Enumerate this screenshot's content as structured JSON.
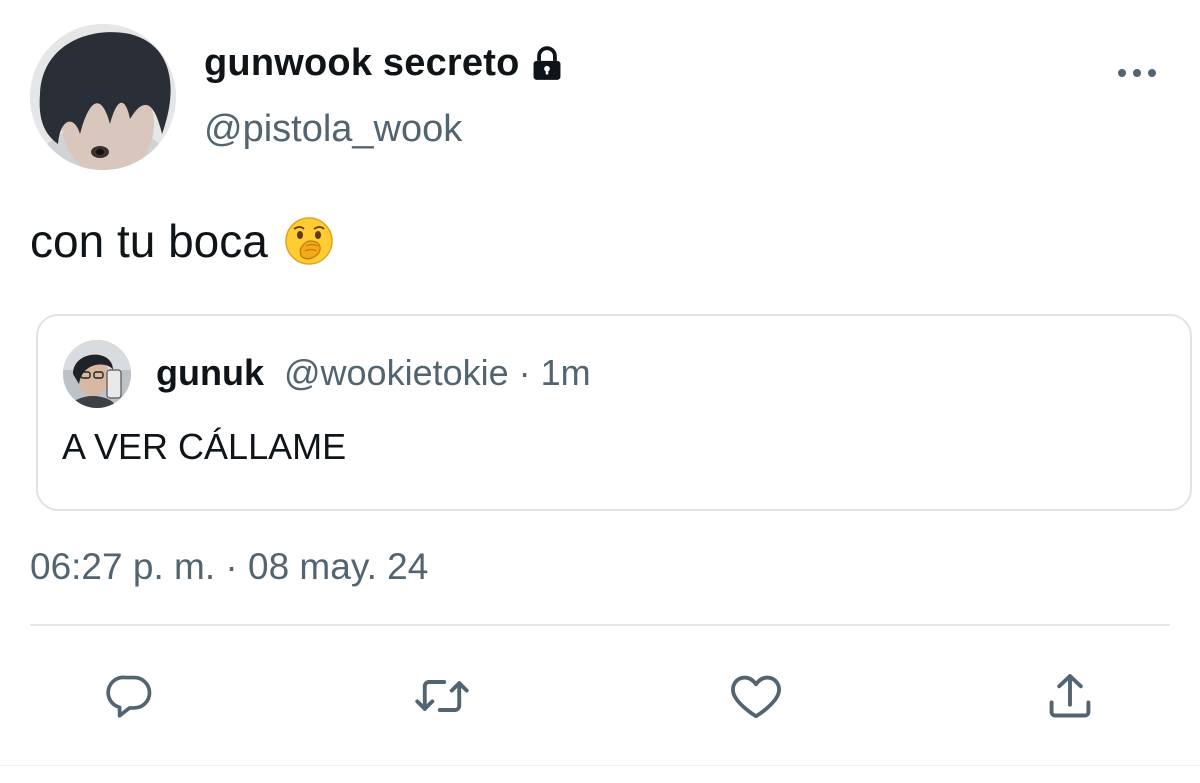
{
  "author": {
    "display_name": "gunwook secreto",
    "handle": "@pistola_wook",
    "lock_icon": "lock-icon",
    "avatar": "avatar-photo"
  },
  "tweet": {
    "text": "con tu boca",
    "emoji_icon": "hand-over-mouth-emoji"
  },
  "quote": {
    "name": "gunuk",
    "handle": "@wookietokie",
    "separator": "·",
    "time": "1m",
    "text": "A VER CÁLLAME",
    "avatar": "avatar-photo"
  },
  "timestamp": "06:27 p. m. · 08 may. 24",
  "actions": [
    {
      "icon": "reply-icon"
    },
    {
      "icon": "retweet-icon"
    },
    {
      "icon": "like-icon"
    },
    {
      "icon": "share-icon"
    }
  ],
  "colors": {
    "text": "#0f1419",
    "secondary": "#536471",
    "border": "#dfe3e8"
  }
}
